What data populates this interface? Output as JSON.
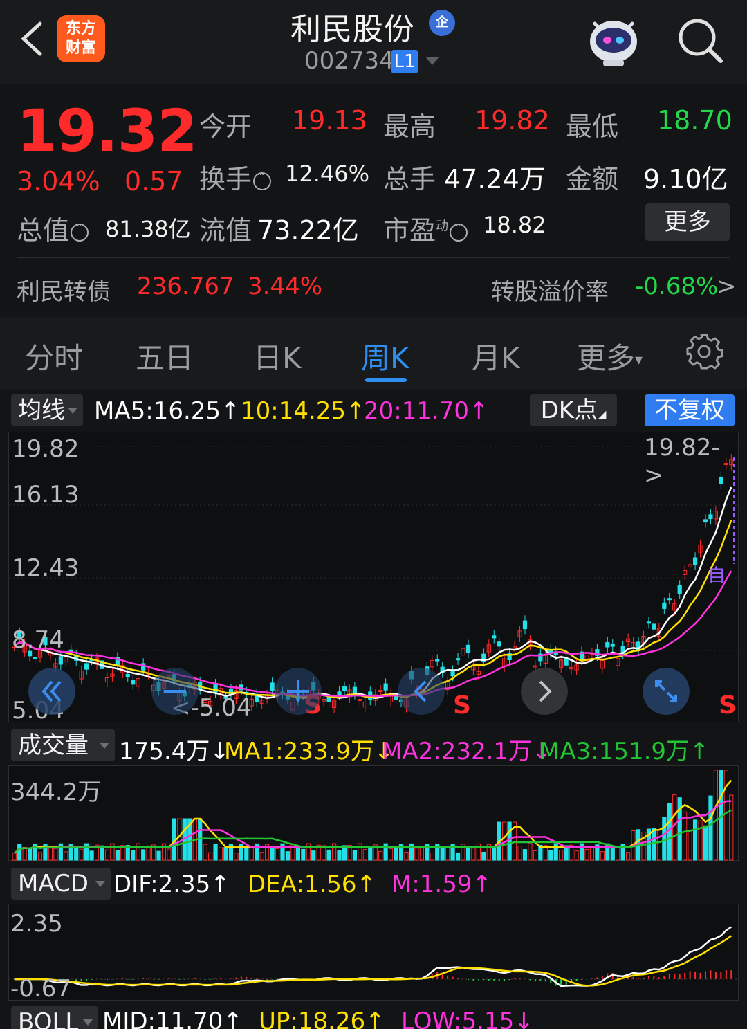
{
  "header": {
    "logo_line1": "东方",
    "logo_line2": "财富",
    "title": "利民股份",
    "title_badge": "企",
    "code": "002734",
    "level": "L1"
  },
  "quote": {
    "price": "19.32",
    "change_pct": "3.04%",
    "change": "0.57",
    "open_label": "今开",
    "open": "19.13",
    "high_label": "最高",
    "high": "19.82",
    "low_label": "最低",
    "low": "18.70",
    "turnover_label": "换手",
    "turnover": "12.46%",
    "volume_label": "总手",
    "volume": "47.24万",
    "amount_label": "金额",
    "amount": "9.10亿",
    "mktcap_label": "总值",
    "mktcap": "81.38亿",
    "float_label": "流值",
    "float": "73.22亿",
    "pe_label": "市盈",
    "pe_sup": "动",
    "pe": "18.82",
    "more_label": "更多"
  },
  "bond": {
    "name": "利民转债",
    "price": "236.767",
    "pct": "3.44%",
    "premium_label": "转股溢价率",
    "premium": "-0.68%",
    "arrow": ">"
  },
  "tabs": [
    "分时",
    "五日",
    "日K",
    "周K",
    "月K",
    "更多"
  ],
  "tab_active": 3,
  "kline": {
    "selector": "均线",
    "ma5": "MA5:16.25",
    "ma10": "10:14.25",
    "ma20": "20:11.70",
    "dk_label": "DK点",
    "adjust_label": "不复权",
    "axis": [
      "19.82",
      "16.13",
      "12.43",
      "8.74",
      "5.04"
    ],
    "max_label": "19.82->",
    "min_label": "<-5.04",
    "zi_mark": "自",
    "s_mark": "S"
  },
  "volume": {
    "selector": "成交量",
    "current": "175.4万",
    "ma1": "MA1:233.9万",
    "ma2": "MA2:232.1万",
    "ma3": "MA3:151.9万",
    "axis_max": "344.2万"
  },
  "macd": {
    "selector": "MACD",
    "dif": "DIF:2.35",
    "dea": "DEA:1.56",
    "m": "M:1.59",
    "axis_top": "2.35",
    "axis_bottom": "-0.67"
  },
  "boll": {
    "selector": "BOLL",
    "mid": "MID:11.70",
    "up": "UP:18.26",
    "low": "LOW:5.15"
  },
  "colors": {
    "up": "#ff2b2b",
    "down": "#22d84a",
    "accent": "#2f8ff0",
    "ma5": "#ffffff",
    "ma10": "#ffe000",
    "ma20": "#ff33dd",
    "ma3": "#22c534"
  },
  "arrows": {
    "up": "↑",
    "down": "↓"
  }
}
